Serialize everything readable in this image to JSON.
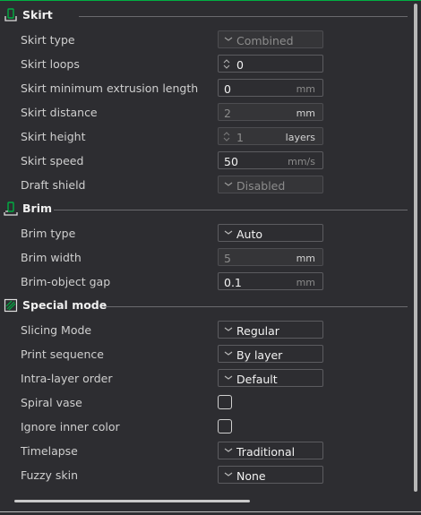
{
  "sections": {
    "skirt": {
      "title": "Skirt",
      "icon": "skirt-icon",
      "rows": {
        "type": {
          "label": "Skirt type",
          "value": "Combined"
        },
        "loops": {
          "label": "Skirt loops",
          "value": "0"
        },
        "min_len": {
          "label": "Skirt minimum extrusion length",
          "value": "0",
          "unit": "mm"
        },
        "distance": {
          "label": "Skirt distance",
          "value": "2",
          "unit": "mm"
        },
        "height": {
          "label": "Skirt height",
          "value": "1",
          "unit": "layers"
        },
        "speed": {
          "label": "Skirt speed",
          "value": "50",
          "unit": "mm/s"
        },
        "draft": {
          "label": "Draft shield",
          "value": "Disabled"
        }
      }
    },
    "brim": {
      "title": "Brim",
      "icon": "brim-icon",
      "rows": {
        "type": {
          "label": "Brim type",
          "value": "Auto"
        },
        "width": {
          "label": "Brim width",
          "value": "5",
          "unit": "mm"
        },
        "gap": {
          "label": "Brim-object gap",
          "value": "0.1",
          "unit": "mm"
        }
      }
    },
    "special": {
      "title": "Special mode",
      "icon": "special-mode-icon",
      "rows": {
        "slicing": {
          "label": "Slicing Mode",
          "value": "Regular"
        },
        "sequence": {
          "label": "Print sequence",
          "value": "By layer"
        },
        "intra": {
          "label": "Intra-layer order",
          "value": "Default"
        },
        "spiral": {
          "label": "Spiral vase",
          "checked": false
        },
        "ignore": {
          "label": "Ignore inner color",
          "checked": false
        },
        "timelapse": {
          "label": "Timelapse",
          "value": "Traditional"
        },
        "fuzzy": {
          "label": "Fuzzy skin",
          "value": "None"
        }
      }
    }
  },
  "colors": {
    "background": "#2d2d31",
    "accent": "#00ae42",
    "text": "#cfcfcf"
  }
}
